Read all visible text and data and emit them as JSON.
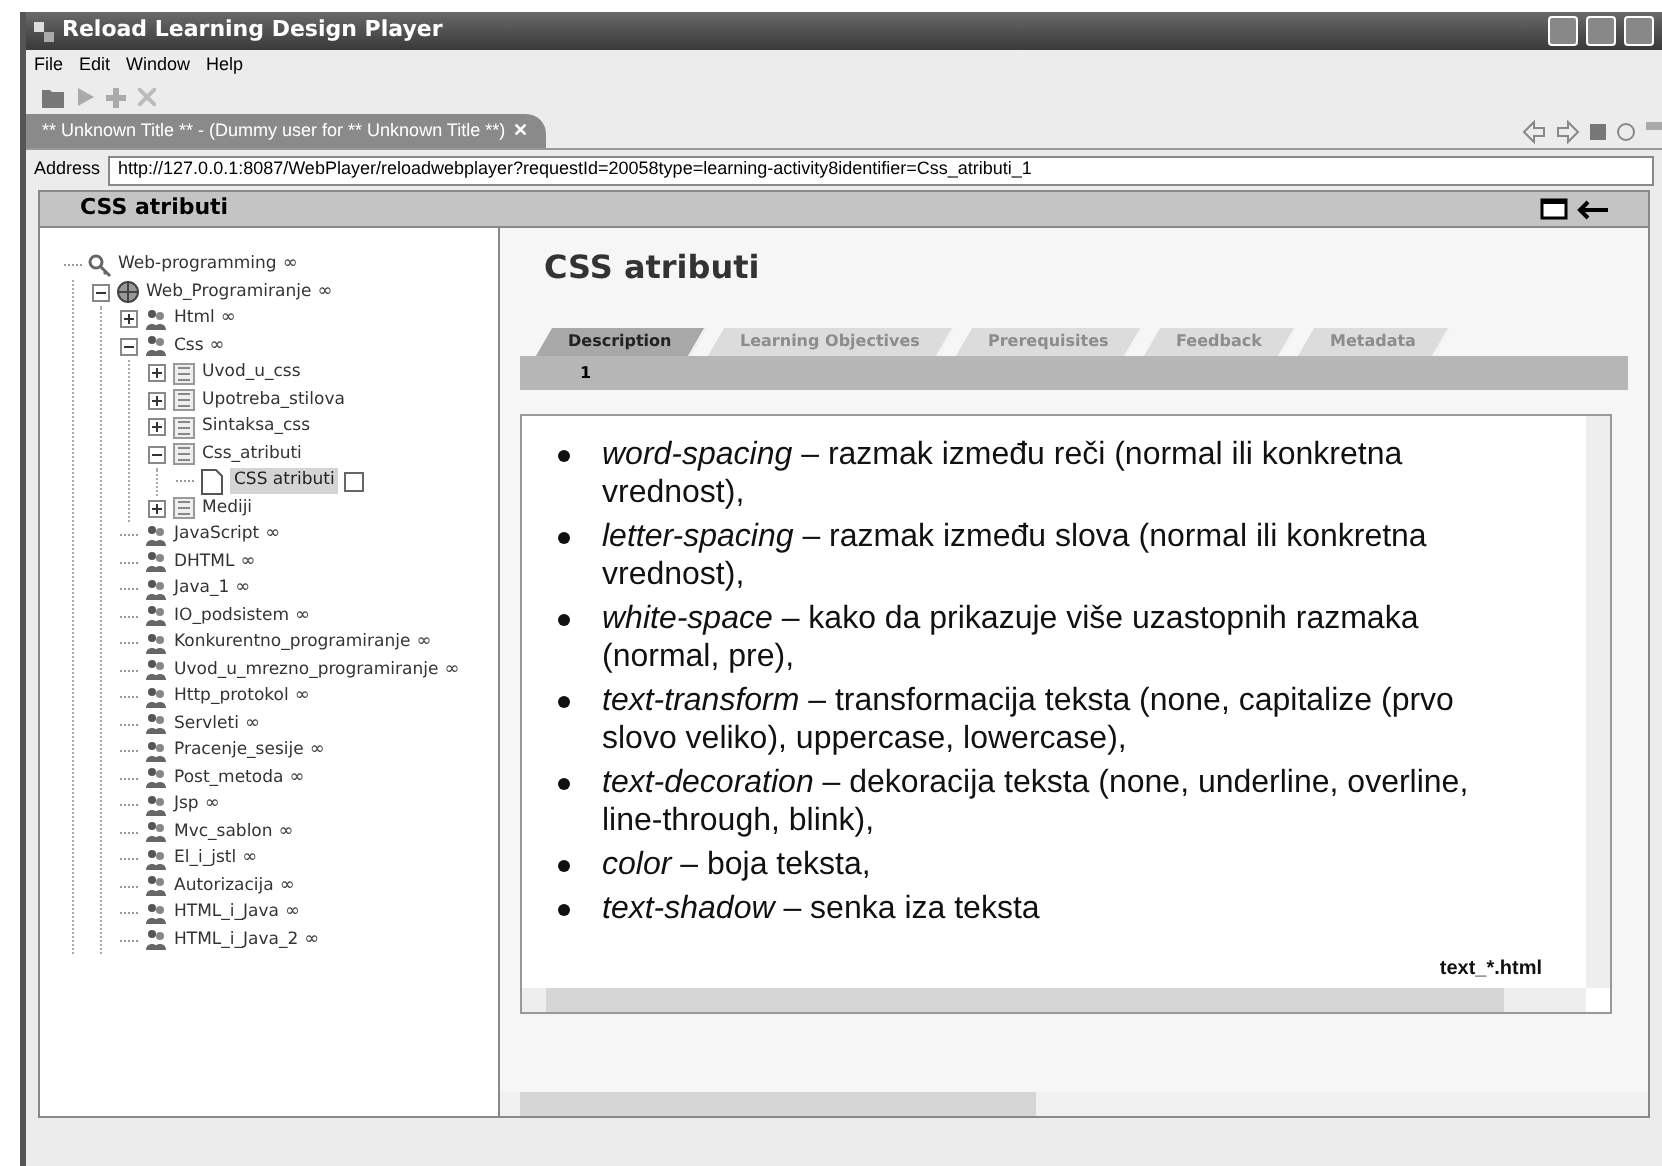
{
  "window": {
    "title": "Reload Learning Design Player"
  },
  "menu": [
    "File",
    "Edit",
    "Window",
    "Help"
  ],
  "editor_tab": {
    "title": "** Unknown Title ** - (Dummy user for ** Unknown Title **)",
    "close": "✕"
  },
  "address": {
    "label": "Address",
    "value": "http://127.0.0.1:8087/WebPlayer/reloadwebplayer?requestId=20058type=learning-activity8identifier=Css_atributi_1"
  },
  "panel": {
    "title": "CSS atributi"
  },
  "tree": [
    {
      "label": "Web-programming",
      "kind": "key",
      "suffix": "∞",
      "children": [
        {
          "label": "Web_Programiranje",
          "kind": "globe",
          "suffix": "∞",
          "expanded": true,
          "children": [
            {
              "label": "Html",
              "kind": "people",
              "suffix": "∞",
              "expanded": false
            },
            {
              "label": "Css",
              "kind": "people",
              "suffix": "∞",
              "expanded": true,
              "children": [
                {
                  "label": "Uvod_u_css",
                  "kind": "section",
                  "expanded": false
                },
                {
                  "label": "Upotreba_stilova",
                  "kind": "section",
                  "expanded": false
                },
                {
                  "label": "Sintaksa_css",
                  "kind": "section",
                  "expanded": false
                },
                {
                  "label": "Css_atributi",
                  "kind": "section",
                  "expanded": true,
                  "children": [
                    {
                      "label": "CSS atributi",
                      "kind": "page",
                      "selected": true,
                      "checked": false
                    }
                  ]
                },
                {
                  "label": "Mediji",
                  "kind": "section",
                  "expanded": false
                }
              ]
            },
            {
              "label": "JavaScript",
              "kind": "people",
              "suffix": "∞"
            },
            {
              "label": "DHTML",
              "kind": "people",
              "suffix": "∞"
            },
            {
              "label": "Java_1",
              "kind": "people",
              "suffix": "∞"
            },
            {
              "label": "IO_podsistem",
              "kind": "people",
              "suffix": "∞"
            },
            {
              "label": "Konkurentno_programiranje",
              "kind": "people",
              "suffix": "∞"
            },
            {
              "label": "Uvod_u_mrezno_programiranje",
              "kind": "people",
              "suffix": "∞"
            },
            {
              "label": "Http_protokol",
              "kind": "people",
              "suffix": "∞"
            },
            {
              "label": "Servleti",
              "kind": "people",
              "suffix": "∞"
            },
            {
              "label": "Pracenje_sesije",
              "kind": "people",
              "suffix": "∞"
            },
            {
              "label": "Post_metoda",
              "kind": "people",
              "suffix": "∞"
            },
            {
              "label": "Jsp",
              "kind": "people",
              "suffix": "∞"
            },
            {
              "label": "Mvc_sablon",
              "kind": "people",
              "suffix": "∞"
            },
            {
              "label": "El_i_jstl",
              "kind": "people",
              "suffix": "∞"
            },
            {
              "label": "Autorizacija",
              "kind": "people",
              "suffix": "∞"
            },
            {
              "label": "HTML_i_Java",
              "kind": "people",
              "suffix": "∞"
            },
            {
              "label": "HTML_i_Java_2",
              "kind": "people",
              "suffix": "∞"
            }
          ]
        }
      ]
    }
  ],
  "activity": {
    "title": "CSS atributi",
    "tabs": [
      {
        "label": "Description",
        "selected": true
      },
      {
        "label": "Learning Objectives",
        "selected": false
      },
      {
        "label": "Prerequisites",
        "selected": false
      },
      {
        "label": "Feedback",
        "selected": false
      },
      {
        "label": "Metadata",
        "selected": false
      }
    ],
    "page_number": "1",
    "bullets": [
      "*word-spacing* – razmak između reči (normal ili konkretna vrednost),",
      "*letter-spacing* – razmak između slova (normal ili konkretna vrednost),",
      "*white-space* – kako da prikazuje više uzastopnih razmaka (normal, pre),",
      "*text-transform* – transformacija teksta (none, capitalize (prvo slovo veliko), uppercase, lowercase),",
      "*text-decoration* – dekoracija teksta (none, underline, overline, line-through, blink),",
      "*color* – boja teksta,",
      "*text-shadow* – senka iza teksta"
    ],
    "clipped_text": "text_*.html"
  }
}
